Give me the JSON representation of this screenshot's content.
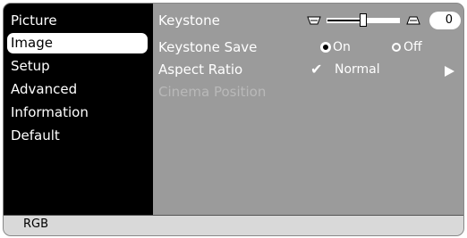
{
  "menu": {
    "items": [
      {
        "label": "Picture"
      },
      {
        "label": "Image"
      },
      {
        "label": "Setup"
      },
      {
        "label": "Advanced"
      },
      {
        "label": "Information"
      },
      {
        "label": "Default"
      }
    ],
    "selected": "Image"
  },
  "settings": {
    "keystone": {
      "label": "Keystone",
      "value": "0",
      "slider_fraction": 0.5,
      "left_icon": "keystone-wide-top-icon",
      "right_icon": "keystone-wide-bottom-icon"
    },
    "keystone_save": {
      "label": "Keystone Save",
      "option_on": "On",
      "option_off": "Off",
      "selected": "On"
    },
    "aspect_ratio": {
      "label": "Aspect Ratio",
      "value": "Normal",
      "check": "✔"
    },
    "cinema_position": {
      "label": "Cinema Position",
      "enabled": false
    }
  },
  "status": {
    "source": "RGB"
  },
  "colors": {
    "background": "#9b9b9b",
    "sidebar": "#000000",
    "text": "#ffffff",
    "disabled_text": "#b9b9b9",
    "status_bar": "#d9d9d9"
  }
}
